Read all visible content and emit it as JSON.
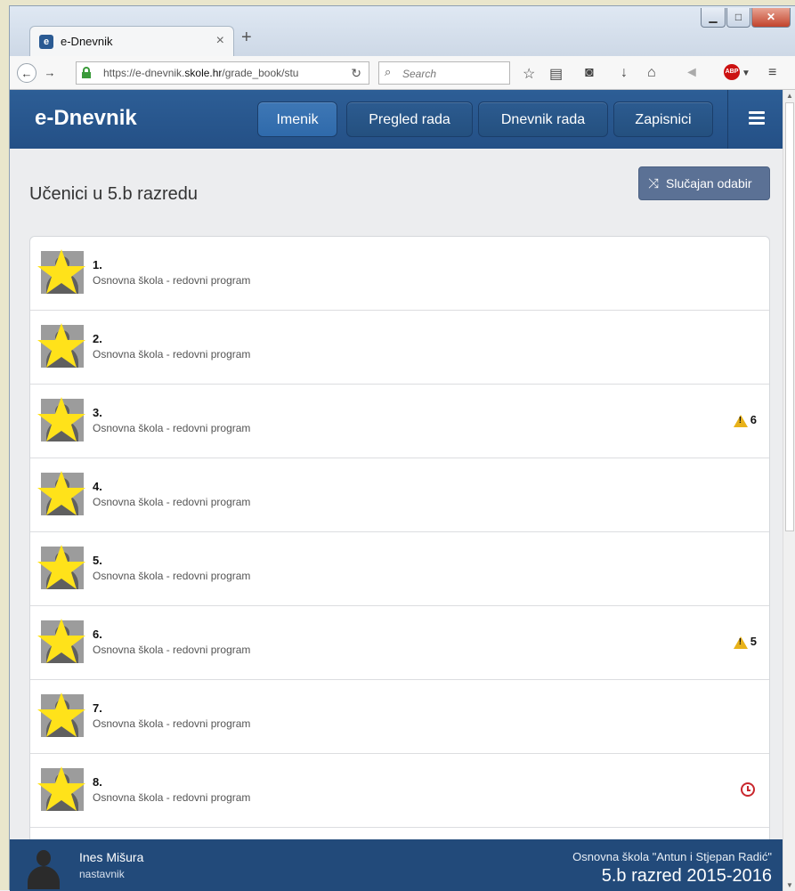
{
  "browser": {
    "tab_title": "e-Dnevnik",
    "tab_favicon": "e",
    "url_prefix": "https://e-dnevnik.",
    "url_domain": "skole.hr",
    "url_path": "/grade_book/stu",
    "search_placeholder": "Search",
    "abp_label": "ABP"
  },
  "app": {
    "brand": "e-Dnevnik",
    "nav": [
      {
        "label": "Imenik",
        "active": true
      },
      {
        "label": "Pregled rada",
        "active": false
      },
      {
        "label": "Dnevnik rada",
        "active": false
      },
      {
        "label": "Zapisnici",
        "active": false
      }
    ],
    "page_title": "Učenici u 5.b razredu",
    "random_button": "Slučajan odabir"
  },
  "students": [
    {
      "num": "1.",
      "program": "Osnovna škola - redovni program",
      "warning": null,
      "clock": false
    },
    {
      "num": "2.",
      "program": "Osnovna škola - redovni program",
      "warning": null,
      "clock": false
    },
    {
      "num": "3.",
      "program": "Osnovna škola - redovni program",
      "warning": "6",
      "clock": false
    },
    {
      "num": "4.",
      "program": "Osnovna škola - redovni program",
      "warning": null,
      "clock": false
    },
    {
      "num": "5.",
      "program": "Osnovna škola - redovni program",
      "warning": null,
      "clock": false
    },
    {
      "num": "6.",
      "program": "Osnovna škola - redovni program",
      "warning": "5",
      "clock": false
    },
    {
      "num": "7.",
      "program": "Osnovna škola - redovni program",
      "warning": null,
      "clock": false
    },
    {
      "num": "8.",
      "program": "Osnovna škola - redovni program",
      "warning": null,
      "clock": true
    }
  ],
  "footer": {
    "user_name": "Ines Mišura",
    "user_role": "nastavnik",
    "school": "Osnovna škola \"Antun i Stjepan Radić\"",
    "class_year": "5.b razred 2015-2016"
  },
  "colors": {
    "header_blue": "#2a5890",
    "footer_blue": "#224a7a",
    "warning_yellow": "#e8b21a",
    "clock_red": "#c9272d",
    "star_yellow": "#ffe21a"
  }
}
